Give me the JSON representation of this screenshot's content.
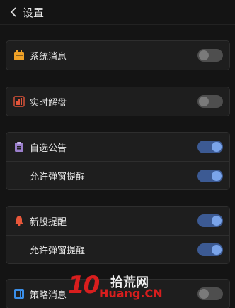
{
  "header": {
    "title": "设置"
  },
  "groups": [
    {
      "rows": [
        {
          "label": "系统消息",
          "icon": "calendar-icon",
          "icon_color": "#f0a227",
          "toggle": false
        }
      ]
    },
    {
      "rows": [
        {
          "label": "实时解盘",
          "icon": "bar-chart-icon",
          "icon_color": "#e0543a",
          "toggle": false
        }
      ]
    },
    {
      "rows": [
        {
          "label": "自选公告",
          "icon": "clipboard-icon",
          "icon_color": "#9b7fcc",
          "toggle": true
        },
        {
          "label": "允许弹窗提醒",
          "toggle": true
        }
      ]
    },
    {
      "rows": [
        {
          "label": "新股提醒",
          "icon": "bell-icon",
          "icon_color": "#e8573a",
          "toggle": true
        },
        {
          "label": "允许弹窗提醒",
          "toggle": true
        }
      ]
    },
    {
      "rows": [
        {
          "label": "策略消息",
          "icon": "strategy-icon",
          "icon_color": "#3a8ee8",
          "toggle": false
        }
      ]
    }
  ],
  "watermark": {
    "number": "10",
    "cn": "拾荒网",
    "en": "Huang.CN"
  },
  "colors": {
    "background": "#141414",
    "card": "#1e1e1e",
    "toggle_on": "#3c5a93",
    "toggle_off": "#4e4e4e"
  }
}
